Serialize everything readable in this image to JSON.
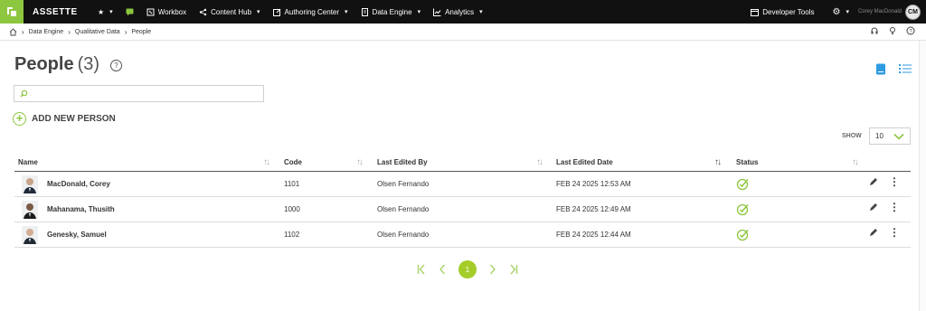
{
  "topbar": {
    "brand": "ASSETTE",
    "nav": [
      {
        "label": "Workbox"
      },
      {
        "label": "Content Hub"
      },
      {
        "label": "Authoring Center"
      },
      {
        "label": "Data Engine"
      },
      {
        "label": "Analytics"
      }
    ],
    "developer_tools": "Developer Tools",
    "user_name": "Corey MacDonald",
    "user_initials": "CM"
  },
  "breadcrumb": [
    "Data Engine",
    "Qualitative Data",
    "People"
  ],
  "page": {
    "title": "People",
    "count": "(3)",
    "help": "?"
  },
  "search": {
    "value": ""
  },
  "add_button": "ADD NEW PERSON",
  "show": {
    "label": "SHOW",
    "value": "10"
  },
  "table": {
    "headers": {
      "name": "Name",
      "code": "Code",
      "edited_by": "Last Edited By",
      "edited_date": "Last Edited Date",
      "status": "Status"
    },
    "rows": [
      {
        "name": "MacDonald, Corey",
        "code": "1101",
        "edited_by": "Olsen Fernando",
        "edited_date": "FEB 24 2025 12:53 AM"
      },
      {
        "name": "Mahanama, Thusith",
        "code": "1000",
        "edited_by": "Olsen Fernando",
        "edited_date": "FEB 24 2025 12:49 AM"
      },
      {
        "name": "Genesky, Samuel",
        "code": "1102",
        "edited_by": "Olsen Fernando",
        "edited_date": "FEB 24 2025 12:44 AM"
      }
    ]
  },
  "pagination": {
    "current": "1"
  },
  "colors": {
    "accent": "#8dc63f",
    "topbar": "#111111",
    "link_blue": "#2e9ae0"
  }
}
